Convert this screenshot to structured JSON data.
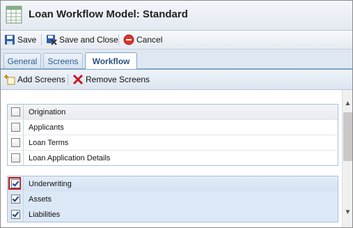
{
  "window": {
    "title": "Loan Workflow Model: Standard",
    "icon": "spreadsheet-icon"
  },
  "toolbar": {
    "save_label": "Save",
    "save_close_label": "Save and Close",
    "cancel_label": "Cancel"
  },
  "tabs": [
    {
      "label": "General",
      "active": false
    },
    {
      "label": "Screens",
      "active": false
    },
    {
      "label": "Workflow",
      "active": true
    }
  ],
  "subtoolbar": {
    "add_label": "Add Screens",
    "remove_label": "Remove Screens"
  },
  "groups": [
    {
      "rows": [
        {
          "label": "Origination",
          "checked": false,
          "header": true
        },
        {
          "label": "Applicants",
          "checked": false
        },
        {
          "label": "Loan Terms",
          "checked": false
        },
        {
          "label": "Loan Application Details",
          "checked": false
        }
      ]
    },
    {
      "rows": [
        {
          "label": "Underwriting",
          "checked": true,
          "header": true,
          "highlighted": true
        },
        {
          "label": "Assets",
          "checked": true
        },
        {
          "label": "Liabilities",
          "checked": true
        }
      ]
    }
  ],
  "colors": {
    "accent": "#2b4f7d",
    "highlight": "#c0121a",
    "selected_row": "#dce8f6"
  }
}
